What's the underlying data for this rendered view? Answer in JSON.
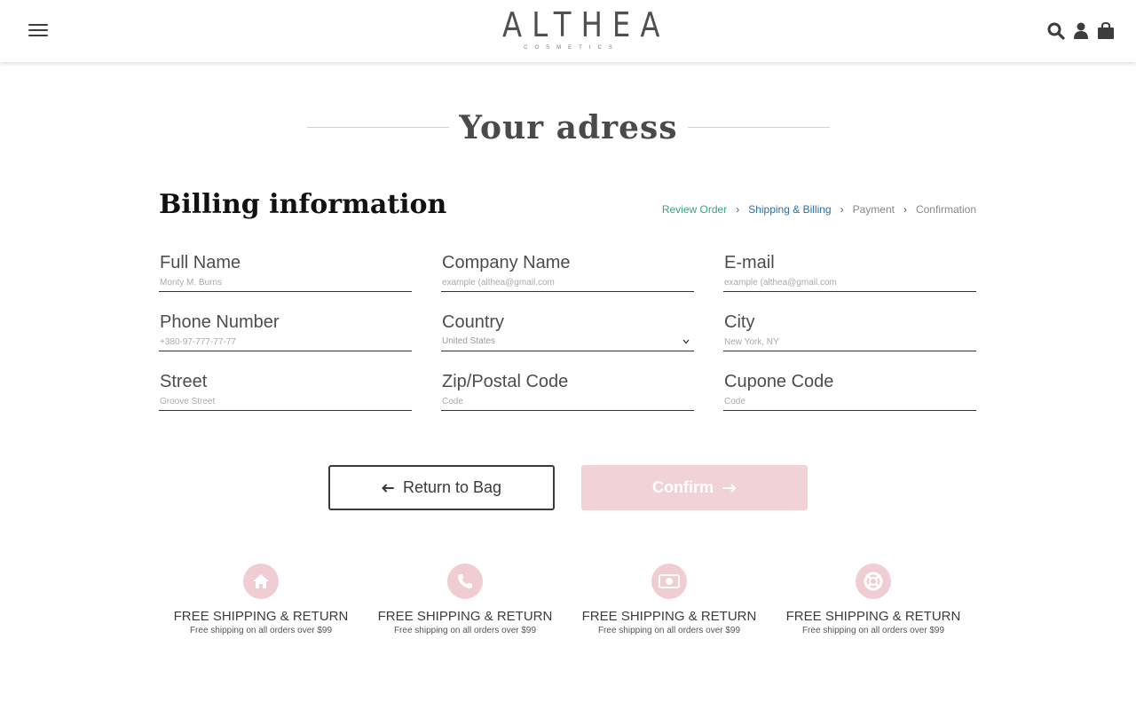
{
  "header": {
    "logo_main": "ALTHEA",
    "logo_sub": "COSMETICS",
    "icons": [
      "menu-icon",
      "search-icon",
      "user-icon",
      "shopping-bag-icon"
    ]
  },
  "page": {
    "title": "Your adress",
    "billing_heading": "Billing information"
  },
  "breadcrumb": [
    {
      "label": "Review Order",
      "color": "#3aa37a"
    },
    {
      "label": "Shipping & Billing",
      "color": "#2d6fa3"
    },
    {
      "label": "Payment",
      "color": "#888888"
    },
    {
      "label": "Confirmation",
      "color": "#888888"
    }
  ],
  "form": {
    "full_name": {
      "label": "Full Name",
      "placeholder": "Monty M. Burns"
    },
    "company_name": {
      "label": "Company Name",
      "placeholder": "example (althea@gmail.com"
    },
    "email": {
      "label": "E-mail",
      "placeholder": "example (althea@gmail.com"
    },
    "phone": {
      "label": "Phone Number",
      "placeholder": "+380-97-777-77-77"
    },
    "country": {
      "label": "Country",
      "value": "United States"
    },
    "city": {
      "label": "City",
      "placeholder": "New York, NY"
    },
    "street": {
      "label": "Street",
      "placeholder": "Groove Street"
    },
    "zip": {
      "label": "Zip/Postal Code",
      "placeholder": "Code"
    },
    "coupon": {
      "label": "Cupone Code",
      "placeholder": "Code"
    }
  },
  "buttons": {
    "return_label": "Return to Bag",
    "confirm_label": "Confirm"
  },
  "features": [
    {
      "icon": "home-icon",
      "title": "FREE SHIPPING & RETURN",
      "subtitle": "Free shipping on all orders over $99"
    },
    {
      "icon": "phone-icon",
      "title": "FREE SHIPPING & RETURN",
      "subtitle": "Free shipping on all orders over $99"
    },
    {
      "icon": "money-icon",
      "title": "FREE SHIPPING & RETURN",
      "subtitle": "Free shipping on all orders over $99"
    },
    {
      "icon": "lifebuoy-icon",
      "title": "FREE SHIPPING & RETURN",
      "subtitle": "Free shipping on all orders over $99"
    }
  ],
  "colors": {
    "accent_pink": "#f0cdd2",
    "confirm_bg": "#f1d3d7",
    "text_dark": "#3d3d3d"
  }
}
